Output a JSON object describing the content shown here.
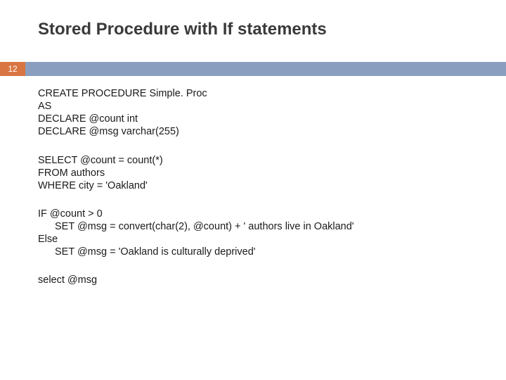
{
  "title": "Stored Procedure with If statements",
  "page_number": "12",
  "code": {
    "b1l1": "CREATE PROCEDURE Simple. Proc",
    "b1l2": "AS",
    "b1l3": "DECLARE @count int",
    "b1l4": "DECLARE @msg varchar(255)",
    "b2l1": "SELECT @count = count(*)",
    "b2l2": "FROM authors",
    "b2l3": "WHERE city = 'Oakland'",
    "b3l1": "IF @count > 0",
    "b3l2": "SET @msg = convert(char(2), @count) + ' authors live in Oakland'",
    "b3l3": "Else",
    "b3l4": "SET @msg = 'Oakland is culturally deprived'",
    "b4l1": "select @msg"
  }
}
